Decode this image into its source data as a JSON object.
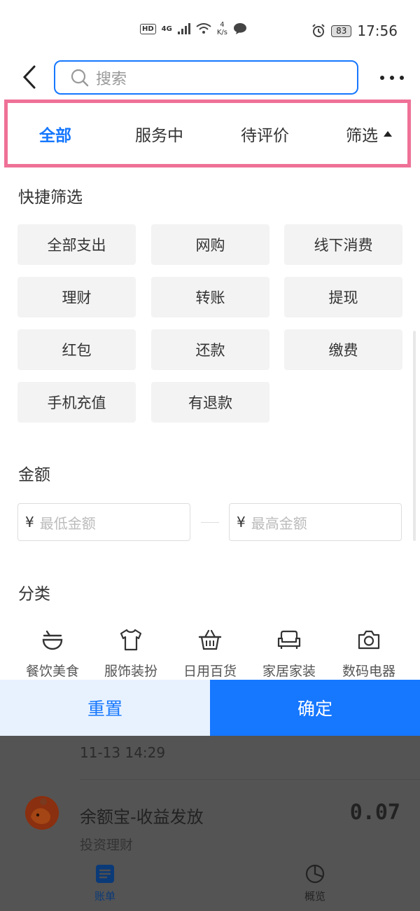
{
  "status_bar": {
    "hd": "HD",
    "network": "4G",
    "speed_value": "4",
    "speed_unit": "K/s",
    "battery": "83",
    "time": "17:56"
  },
  "header": {
    "search_placeholder": "搜索"
  },
  "tabs": [
    {
      "label": "全部",
      "active": true
    },
    {
      "label": "服务中",
      "active": false
    },
    {
      "label": "待评价",
      "active": false
    },
    {
      "label": "筛选",
      "active": false
    }
  ],
  "quick_filter": {
    "title": "快捷筛选",
    "chips": [
      "全部支出",
      "网购",
      "线下消费",
      "理财",
      "转账",
      "提现",
      "红包",
      "还款",
      "缴费",
      "手机充值",
      "有退款"
    ]
  },
  "amount": {
    "title": "金额",
    "currency_symbol": "¥",
    "min_placeholder": "最低金额",
    "max_placeholder": "最高金额"
  },
  "category": {
    "title": "分类",
    "items": [
      {
        "label": "餐饮美食",
        "icon": "bowl-icon"
      },
      {
        "label": "服饰装扮",
        "icon": "shirt-icon"
      },
      {
        "label": "日用百货",
        "icon": "basket-icon"
      },
      {
        "label": "家居家装",
        "icon": "sofa-icon"
      },
      {
        "label": "数码电器",
        "icon": "camera-icon"
      }
    ]
  },
  "actions": {
    "reset": "重置",
    "confirm": "确定"
  },
  "background_list": {
    "time": "11-13  14:29",
    "title": "余额宝-收益发放",
    "amount": "0.07",
    "subtitle": "投资理财"
  },
  "bottom_nav": [
    {
      "label": "账单",
      "active": true
    },
    {
      "label": "概览",
      "active": false
    }
  ],
  "colors": {
    "accent": "#1677ff",
    "highlight_border": "#ef7198",
    "overlay": "#545454"
  }
}
